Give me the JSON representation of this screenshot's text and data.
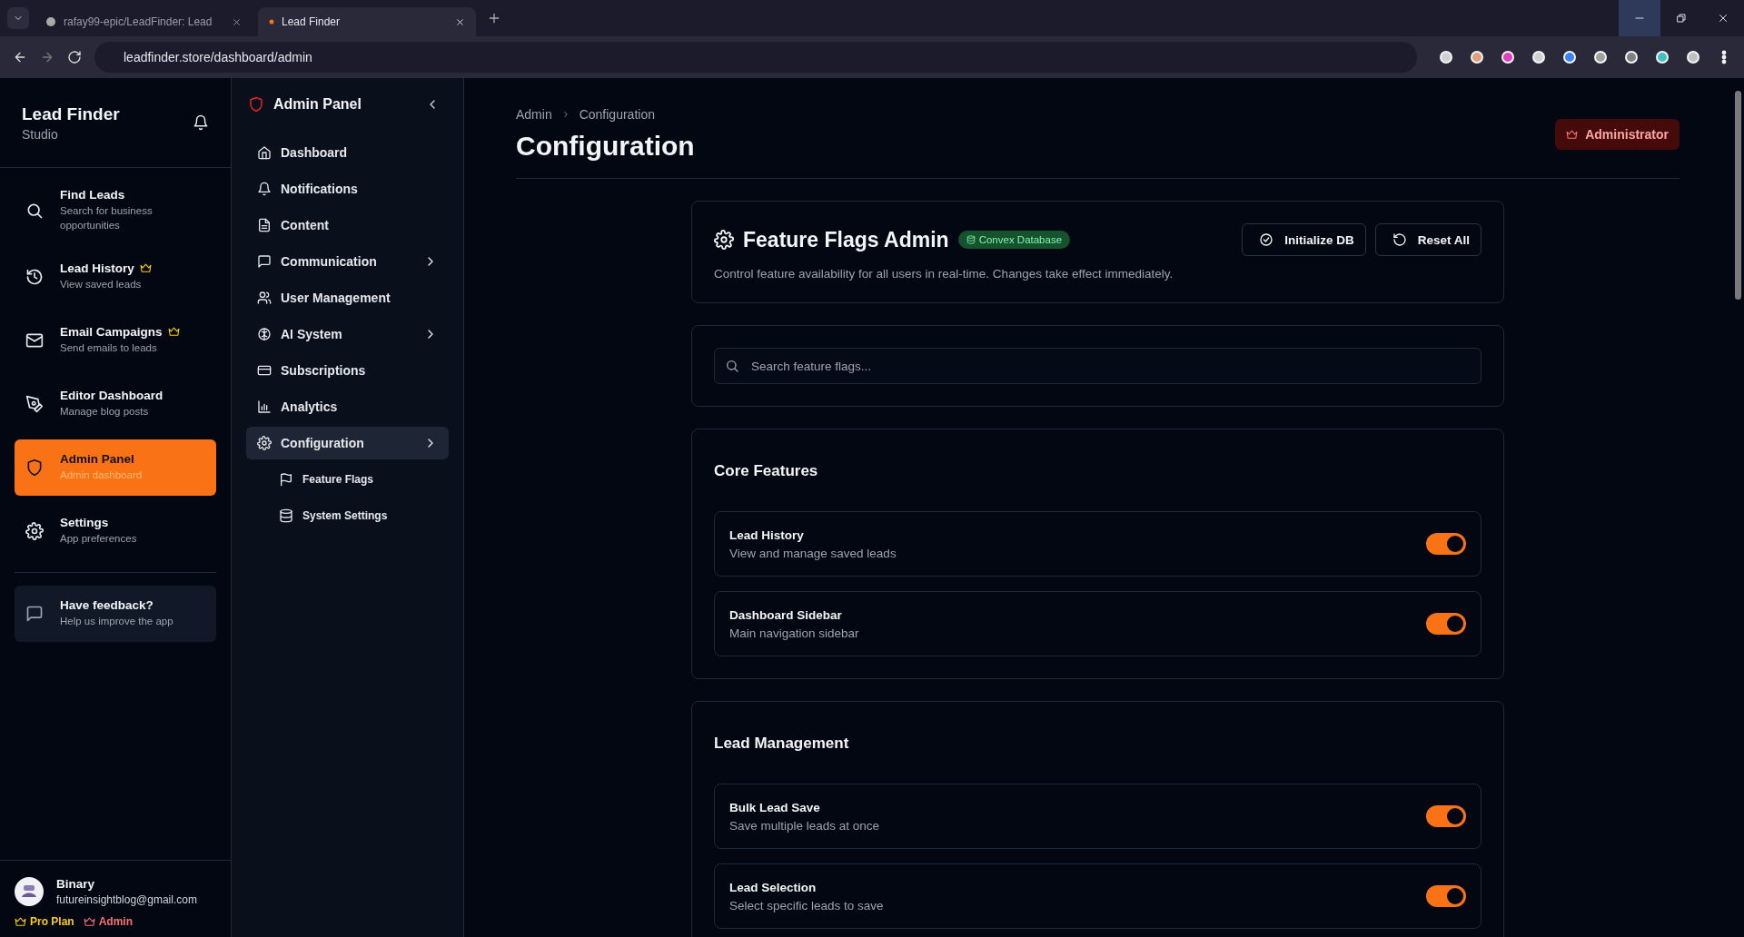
{
  "browser": {
    "tabs": [
      {
        "title": "rafay99-epic/LeadFinder: Lead",
        "selected": false
      },
      {
        "title": "Lead Finder",
        "selected": true
      }
    ],
    "url": "leadfinder.store/dashboard/admin"
  },
  "sidebar": {
    "brand": "Lead Finder",
    "subtitle": "Studio",
    "items": [
      {
        "title": "Find Leads",
        "subtitle": "Search for business opportunities",
        "premium": false,
        "selected": false
      },
      {
        "title": "Lead History",
        "subtitle": "View saved leads",
        "premium": true,
        "selected": false
      },
      {
        "title": "Email Campaigns",
        "subtitle": "Send emails to leads",
        "premium": true,
        "selected": false
      },
      {
        "title": "Editor Dashboard",
        "subtitle": "Manage blog posts",
        "premium": false,
        "selected": false
      },
      {
        "title": "Admin Panel",
        "subtitle": "Admin dashboard",
        "premium": false,
        "selected": true
      },
      {
        "title": "Settings",
        "subtitle": "App preferences",
        "premium": false,
        "selected": false
      }
    ],
    "feedback": {
      "title": "Have feedback?",
      "subtitle": "Help us improve the app"
    },
    "user": {
      "name": "Binary",
      "email": "futureinsightblog@gmail.com",
      "plan": "Pro Plan",
      "role": "Admin"
    }
  },
  "admin_nav": {
    "title": "Admin Panel",
    "items": [
      {
        "label": "Dashboard",
        "has_submenu": false,
        "selected": false
      },
      {
        "label": "Notifications",
        "has_submenu": false,
        "selected": false
      },
      {
        "label": "Content",
        "has_submenu": false,
        "selected": false
      },
      {
        "label": "Communication",
        "has_submenu": true,
        "selected": false
      },
      {
        "label": "User Management",
        "has_submenu": false,
        "selected": false
      },
      {
        "label": "AI System",
        "has_submenu": true,
        "selected": false
      },
      {
        "label": "Subscriptions",
        "has_submenu": false,
        "selected": false
      },
      {
        "label": "Analytics",
        "has_submenu": false,
        "selected": false
      },
      {
        "label": "Configuration",
        "has_submenu": true,
        "selected": true,
        "children": [
          {
            "label": "Feature Flags",
            "selected": false
          },
          {
            "label": "System Settings",
            "selected": false
          }
        ]
      }
    ]
  },
  "main": {
    "breadcrumbs": [
      "Admin",
      "Configuration"
    ],
    "title": "Configuration",
    "role_badge": "Administrator",
    "flags_header": {
      "title": "Feature Flags Admin",
      "badge": "Convex Database",
      "description": "Control feature availability for all users in real-time. Changes take effect immediately.",
      "buttons": [
        "Initialize DB",
        "Reset All"
      ]
    },
    "search": {
      "placeholder": "Search feature flags..."
    },
    "sections": [
      {
        "title": "Core Features",
        "flags": [
          {
            "name": "Lead History",
            "description": "View and manage saved leads",
            "on": true
          },
          {
            "name": "Dashboard Sidebar",
            "description": "Main navigation sidebar",
            "on": true
          }
        ]
      },
      {
        "title": "Lead Management",
        "flags": [
          {
            "name": "Bulk Lead Save",
            "description": "Save multiple leads at once",
            "on": true
          },
          {
            "name": "Lead Selection",
            "description": "Select specific leads to save",
            "on": true
          }
        ]
      }
    ]
  }
}
